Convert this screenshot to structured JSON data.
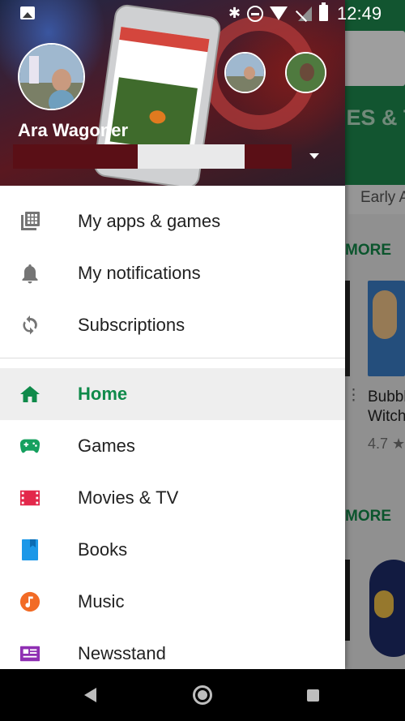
{
  "status_bar": {
    "time": "12:49"
  },
  "drawer": {
    "account": {
      "name": "Ara Wagoner"
    },
    "menu_primary": [
      {
        "label": "My apps & games",
        "icon": "apps-grid-icon"
      },
      {
        "label": "My notifications",
        "icon": "bell-icon"
      },
      {
        "label": "Subscriptions",
        "icon": "refresh-icon"
      }
    ],
    "menu_categories": [
      {
        "label": "Home",
        "icon": "home-icon",
        "color": "#0f8a4a",
        "active": true
      },
      {
        "label": "Games",
        "icon": "gamepad-icon",
        "color": "#16a05f"
      },
      {
        "label": "Movies & TV",
        "icon": "film-icon",
        "color": "#e3284b"
      },
      {
        "label": "Books",
        "icon": "book-icon",
        "color": "#1c98e8"
      },
      {
        "label": "Music",
        "icon": "music-icon",
        "color": "#f26b25"
      },
      {
        "label": "Newsstand",
        "icon": "newsstand-icon",
        "color": "#8f2fb3"
      }
    ]
  },
  "background": {
    "tab_text": "IES & T",
    "early_text": "Early A",
    "more_1": "MORE",
    "more_2": "MORE",
    "app_title": "Bubbl\nWitch",
    "rating": "4.7 ★"
  },
  "colors": {
    "play_green": "#1e8a4e",
    "active_text": "#0f8a4a"
  }
}
